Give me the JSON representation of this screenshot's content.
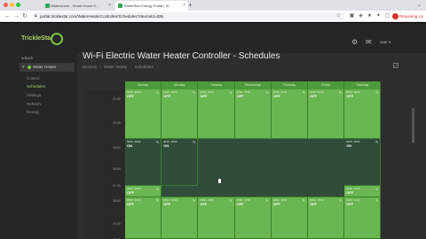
{
  "browser": {
    "tabs": [
      {
        "label": "Watersense - Smart Home S…"
      },
      {
        "label": "TrickleStar Energy Portal | W…"
      }
    ],
    "new_tab_label": "+",
    "url": "portal.tricklestar.com/WaterHeaterController/Schedules?deviceId=835",
    "profile_label": "Resuming Lin"
  },
  "app": {
    "logo": "TrickleStar",
    "user": "user ▾"
  },
  "sidebar": {
    "back_label": "◂ Back",
    "device_label": "Water Heater",
    "items": [
      {
        "label": "Control",
        "active": false
      },
      {
        "label": "Schedules",
        "active": true
      },
      {
        "label": "Settings",
        "active": false
      },
      {
        "label": "Refresh",
        "active": false
      },
      {
        "label": "Energy",
        "active": false
      }
    ]
  },
  "main": {
    "title": "Wi-Fi Electric Water Heater Controller - Schedules",
    "breadcrumb": [
      "Devices",
      "›",
      "Water Heater",
      "›",
      "Schedules"
    ]
  },
  "schedule": {
    "days": [
      "Sunday",
      "Monday",
      "Tuesday",
      "Wednesday",
      "Thursday",
      "Friday",
      "Saturday"
    ],
    "times": [
      "01:00",
      "03:00",
      "05:00",
      "06:00",
      "07:00",
      "08:00",
      "09:00",
      "10:00"
    ],
    "blocks": [
      {
        "day": 0,
        "band": 0,
        "time": "00:00 - 06:00",
        "state": "OFF",
        "kind": "off"
      },
      {
        "day": 1,
        "band": 0,
        "time": "00:00 - 06:00",
        "state": "OFF",
        "kind": "off"
      },
      {
        "day": 2,
        "band": 0,
        "time": "00:00 - 06:00",
        "state": "OFF",
        "kind": "off"
      },
      {
        "day": 3,
        "band": 0,
        "time": "00:00 - 06:00",
        "state": "OFF",
        "kind": "off"
      },
      {
        "day": 4,
        "band": 0,
        "time": "00:00 - 06:00",
        "state": "OFF",
        "kind": "off"
      },
      {
        "day": 5,
        "band": 0,
        "time": "00:00 - 06:00",
        "state": "OFF",
        "kind": "off"
      },
      {
        "day": 6,
        "band": 0,
        "time": "00:00 - 06:00",
        "state": "OFF",
        "kind": "off"
      },
      {
        "day": 0,
        "band": 1,
        "time": "06:00 - 08:00",
        "state": "ON",
        "kind": "on"
      },
      {
        "day": 1,
        "band": 1,
        "time": "06:00 - 08:00",
        "state": "ON",
        "kind": "on"
      },
      {
        "day": 6,
        "band": 1,
        "time": "06:00 - 09:00",
        "state": "ON",
        "kind": "on"
      },
      {
        "day": 0,
        "band": 2,
        "time": "08:00 - 09:00",
        "state": "OFF",
        "kind": "off"
      },
      {
        "day": 6,
        "band": 2,
        "time": "09:00 - 10:00",
        "state": "OFF",
        "kind": "off"
      },
      {
        "day": 0,
        "band": 3,
        "time": "09:00 - 10:00",
        "state": "OFF",
        "kind": "off"
      },
      {
        "day": 1,
        "band": 3,
        "time": "08:00 - 10:00",
        "state": "OFF",
        "kind": "off"
      },
      {
        "day": 2,
        "band": 3,
        "time": "08:00 - 10:00",
        "state": "OFF",
        "kind": "off"
      },
      {
        "day": 3,
        "band": 3,
        "time": "08:00 - 10:00",
        "state": "OFF",
        "kind": "off"
      },
      {
        "day": 4,
        "band": 3,
        "time": "08:00 - 10:00",
        "state": "OFF",
        "kind": "off"
      },
      {
        "day": 5,
        "band": 3,
        "time": "08:00 - 10:00",
        "state": "OFF",
        "kind": "off"
      },
      {
        "day": 6,
        "band": 3,
        "time": "10:00 - 12:00",
        "state": "OFF",
        "kind": "off"
      }
    ],
    "colors": {
      "off": "#6ab652",
      "on": "#2f4d3a",
      "header": "#4d9a3a"
    }
  }
}
